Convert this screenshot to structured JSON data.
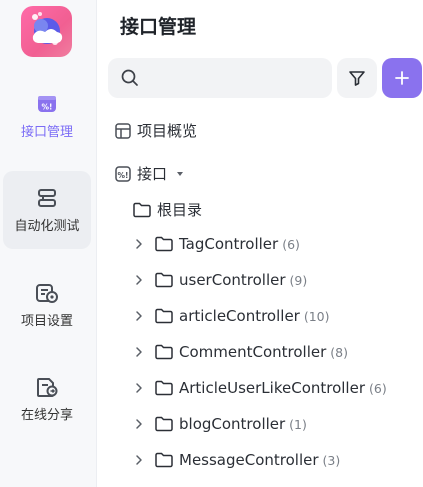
{
  "sidebar": {
    "items": [
      {
        "label": "接口管理",
        "icon": "api-icon",
        "active": true
      },
      {
        "label": "自动化测试",
        "icon": "automation-test-icon",
        "active": false
      },
      {
        "label": "项目设置",
        "icon": "project-settings-icon",
        "active": false
      },
      {
        "label": "在线分享",
        "icon": "online-share-icon",
        "active": false
      }
    ]
  },
  "main": {
    "title": "接口管理",
    "search": {
      "value": "",
      "placeholder": ""
    },
    "tree": {
      "overview_label": "项目概览",
      "api_label": "接口",
      "root_label": "根目录",
      "folders": [
        {
          "name": "TagController",
          "count": "(6)"
        },
        {
          "name": "userController",
          "count": "(9)"
        },
        {
          "name": "articleController",
          "count": "(10)"
        },
        {
          "name": "CommentController",
          "count": "(8)"
        },
        {
          "name": "ArticleUserLikeController",
          "count": "(6)"
        },
        {
          "name": "blogController",
          "count": "(1)"
        },
        {
          "name": "MessageController",
          "count": "(3)"
        }
      ]
    }
  },
  "colors": {
    "accent": "#8a72ee",
    "active_text": "#7b6cf6",
    "rail_bg": "#f7f8fa"
  }
}
